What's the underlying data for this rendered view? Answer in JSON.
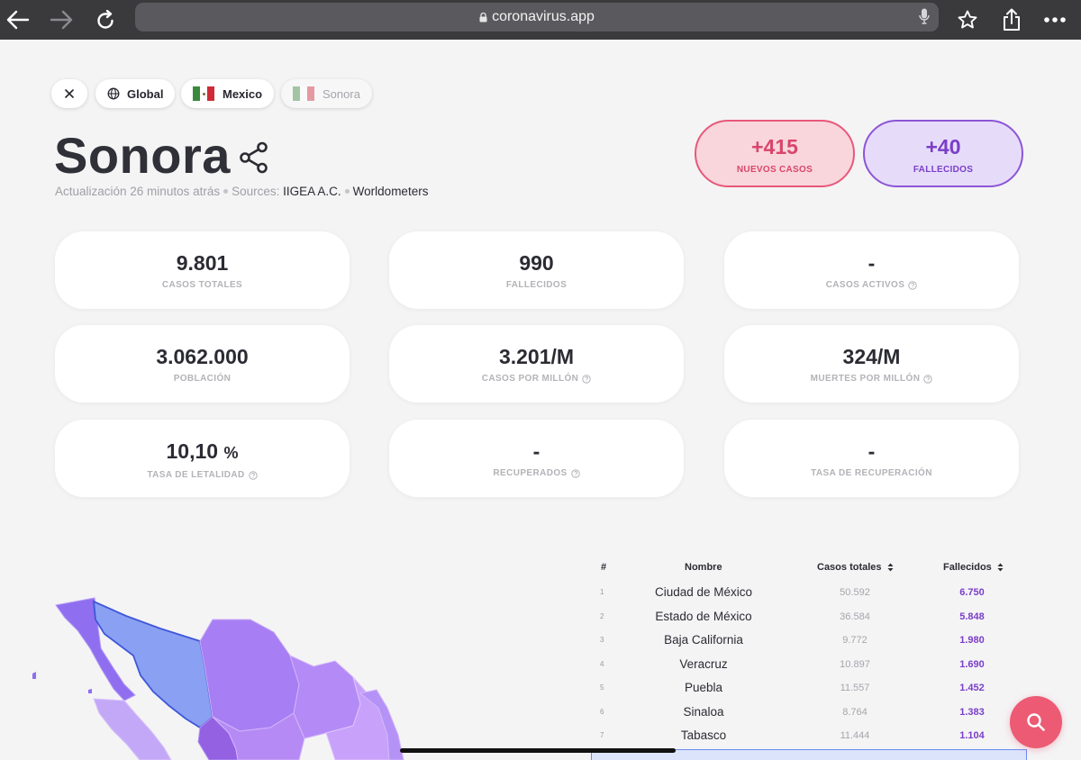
{
  "browser": {
    "url": "coronavirus.app"
  },
  "breadcrumb": {
    "items": [
      {
        "label": "Global"
      },
      {
        "label": "Mexico"
      },
      {
        "label": "Sonora"
      }
    ]
  },
  "header": {
    "title": "Sonora",
    "updated": "Actualización 26 minutos atrás",
    "sources_label": "Sources:",
    "source_1": "IIGEA A.C.",
    "source_2": "Worldometers"
  },
  "pills": {
    "new_cases": {
      "value": "+415",
      "label": "NUEVOS CASOS"
    },
    "deaths": {
      "value": "+40",
      "label": "FALLECIDOS"
    }
  },
  "stats": [
    {
      "value": "9.801",
      "unit": "",
      "label": "CASOS TOTALES"
    },
    {
      "value": "990",
      "unit": "",
      "label": "FALLECIDOS"
    },
    {
      "value": "-",
      "unit": "",
      "label": "CASOS ACTIVOS"
    },
    {
      "value": "3.062.000",
      "unit": "",
      "label": "POBLACIÓN"
    },
    {
      "value": "3.201/M",
      "unit": "",
      "label": "CASOS POR MILLÓN"
    },
    {
      "value": "324/M",
      "unit": "",
      "label": "MUERTES POR MILLÓN"
    },
    {
      "value": "10,10",
      "unit": "%",
      "label": "TASA DE LETALIDAD"
    },
    {
      "value": "-",
      "unit": "",
      "label": "RECUPERADOS"
    },
    {
      "value": "-",
      "unit": "",
      "label": "TASA DE RECUPERACIÓN"
    }
  ],
  "table": {
    "headers": {
      "rank": "#",
      "name": "Nombre",
      "cases": "Casos totales",
      "deaths": "Fallecidos"
    },
    "rows": [
      {
        "rank": "1",
        "name": "Ciudad de México",
        "cases": "50.592",
        "deaths": "6.750"
      },
      {
        "rank": "2",
        "name": "Estado de México",
        "cases": "36.584",
        "deaths": "5.848"
      },
      {
        "rank": "3",
        "name": "Baja California",
        "cases": "9.772",
        "deaths": "1.980"
      },
      {
        "rank": "4",
        "name": "Veracruz",
        "cases": "10.897",
        "deaths": "1.690"
      },
      {
        "rank": "5",
        "name": "Puebla",
        "cases": "11.557",
        "deaths": "1.452"
      },
      {
        "rank": "6",
        "name": "Sinaloa",
        "cases": "8.764",
        "deaths": "1.383"
      },
      {
        "rank": "7",
        "name": "Tabasco",
        "cases": "11.444",
        "deaths": "1.104"
      }
    ]
  },
  "colors": {
    "accent_red": "#e8587a",
    "accent_purple": "#8c55d6",
    "highlight_blue": "#6b8bef"
  }
}
